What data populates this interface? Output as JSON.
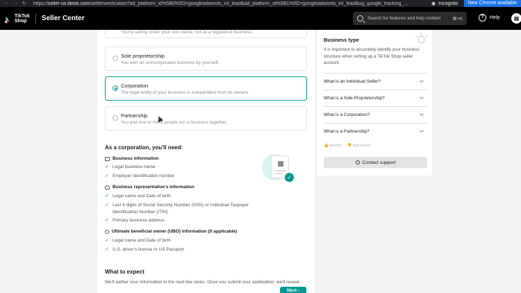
{
  "browser": {
    "url_prefix": "https://",
    "url_host": "seller-us.tiktok.com",
    "url_rest": "/settle/verification?ad_platform_id%5B0%5D=googleadwords_int_lead&ad_platform_id%5B1%5D=googleadwords_int_lead&ug_google_tracking_...",
    "incognito_label": "Incognito",
    "new_chrome_label": "New Chrome available"
  },
  "header": {
    "logo_line1": "TikTok",
    "logo_line2": "Shop",
    "title": "Seller Center",
    "search_placeholder": "Search for features and help content",
    "search_shortcut": "⌘+K",
    "help_label": "Help"
  },
  "options": {
    "top_desc": "You're selling under your own name, not as a registered business.",
    "items": [
      {
        "title": "Sole proprietorship",
        "desc": "You own an unincorporated business by yourself."
      },
      {
        "title": "Corporation",
        "desc": "The legal entity of your business is independent from its owners."
      },
      {
        "title": "Partnership",
        "desc": "You and one or more people run a business together."
      }
    ],
    "selected": "Corporation"
  },
  "requirements": {
    "title": "As a corporation, you'll need:",
    "sections": [
      {
        "heading": "Business information",
        "items": [
          "Legal business name",
          "Employer identification number"
        ]
      },
      {
        "heading": "Business representative's information",
        "items": [
          "Legal name and Date of birth",
          "Last 4 digits of Social Security Number (SSN) or Individual Taxpayer Identification Number (ITIN)",
          "Primary business address"
        ]
      },
      {
        "heading": "Ultimate beneficial owner (UBO) information (if applicable)",
        "items": [
          "Legal name and Date of birth",
          "U.S. driver's license or US Passport"
        ]
      }
    ]
  },
  "expect": {
    "title": "What to expect",
    "body": "We'll gather your information in the next few steps. Once you submit your application, we'll review"
  },
  "next_label": "Next",
  "sidebar": {
    "title": "Business type",
    "description": "It is important to accurately identify your business structure when setting up a TikTok Shop seller account.",
    "faqs": [
      "What is an Individual Seller?",
      "What is a Sole Proprietorship?",
      "What is a Corporation?",
      "What is a Partnership?"
    ],
    "helpful": "Helpful",
    "not_helpful": "Not helpful",
    "contact_label": "Contact support"
  },
  "colors": {
    "accent": "#009995",
    "header_bg": "#000000"
  }
}
